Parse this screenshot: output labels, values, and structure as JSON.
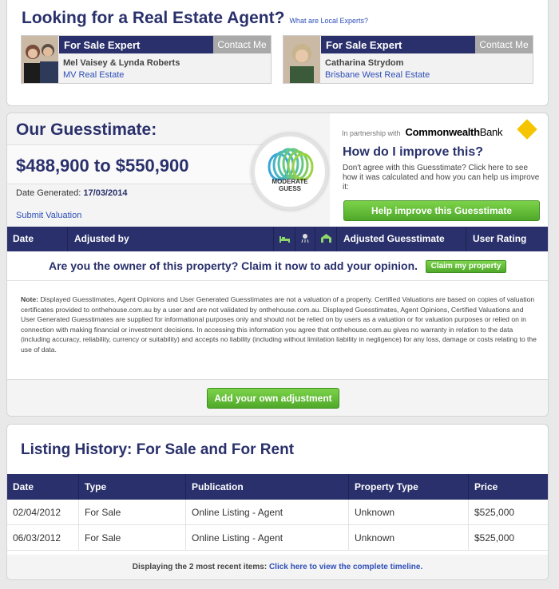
{
  "agents": {
    "title": "Looking for a Real Estate Agent?",
    "what_link": "What are Local Experts?",
    "cards": [
      {
        "label": "For Sale Expert",
        "contact": "Contact Me",
        "name": "Mel Vaisey & Lynda Roberts",
        "agency": "MV Real Estate"
      },
      {
        "label": "For Sale Expert",
        "contact": "Contact Me",
        "name": "Catharina Strydom",
        "agency": "Brisbane West Real Estate"
      }
    ]
  },
  "guess": {
    "title": "Our Guesstimate:",
    "value": "$488,900 to $550,900",
    "date_label": "Date Generated:",
    "date_value": "17/03/2014",
    "submit": "Submit Valuation",
    "gauge_line1": "MODERATE",
    "gauge_line2": "GUESS",
    "partner_text": "In partnership with",
    "partner_brand": "Commonwealth",
    "partner_brand2": "Bank",
    "improve_title": "How do I improve this?",
    "improve_desc": "Don't agree with this Guesstimate? Click here to see how it was calculated and how you can help us improve it:",
    "help_button": "Help improve this Guesstimate",
    "columns": {
      "date": "Date",
      "adjusted_by": "Adjusted by",
      "adjusted_guess": "Adjusted Guesstimate",
      "rating": "User Rating"
    },
    "column_icons": [
      "bed-icon",
      "bath-icon",
      "garage-icon"
    ],
    "claim_text": "Are you the owner of this property? Claim it now to add your opinion.",
    "claim_button": "Claim my property",
    "note_label": "Note:",
    "note_text": " Displayed Guesstimates, Agent Opinions and User Generated Guesstimates are not a valuation of a property. Certified Valuations are based on copies of valuation certificates provided to onthehouse.com.au by a user and are not validated by onthehouse.com.au. Displayed Guesstimates, Agent Opinions, Certified Valuations and User Generated Guesstimates are supplied for informational purposes only and should not be relied on by users as a valuation or for valuation purposes or relied on in connection with making financial or investment decisions. In accessing this information you agree that onthehouse.com.au gives no warranty in relation to the data (including accuracy, reliability, currency or suitability) and accepts no liability (including without limitation liability in negligence) for any loss, damage or costs relating to the use of data.",
    "add_button": "Add your own adjustment"
  },
  "history": {
    "title": "Listing History: For Sale and For Rent",
    "headers": [
      "Date",
      "Type",
      "Publication",
      "Property Type",
      "Price"
    ],
    "rows": [
      [
        "02/04/2012",
        "For Sale",
        "Online Listing - Agent",
        "Unknown",
        "$525,000"
      ],
      [
        "06/03/2012",
        "For Sale",
        "Online Listing - Agent",
        "Unknown",
        "$525,000"
      ]
    ],
    "foot_text": "Displaying the 2 most recent items: ",
    "foot_link": "Click here to view the complete timeline."
  },
  "colors": {
    "navy": "#29306b",
    "green": "#5cb833",
    "link": "#2f4fb8",
    "cba_yellow": "#f4c500"
  }
}
